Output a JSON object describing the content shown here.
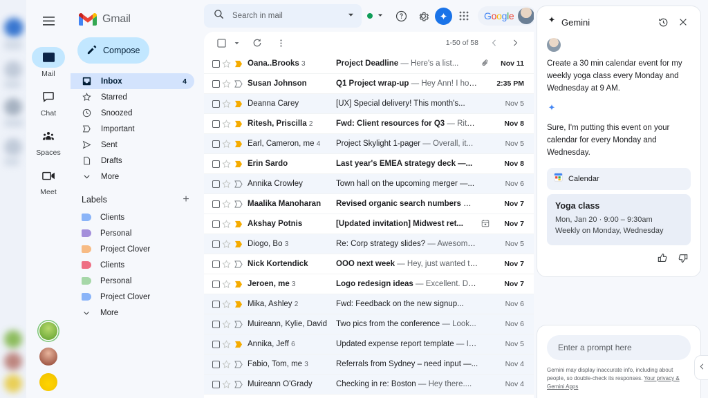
{
  "rail": {
    "menu_icon": "hamburger-icon",
    "items": [
      {
        "label": "Mail",
        "icon": "mail-icon",
        "active": true
      },
      {
        "label": "Chat",
        "icon": "chat-icon",
        "active": false
      },
      {
        "label": "Spaces",
        "icon": "spaces-icon",
        "active": false
      },
      {
        "label": "Meet",
        "icon": "meet-icon",
        "active": false
      }
    ]
  },
  "brand": {
    "name": "Gmail"
  },
  "compose": {
    "label": "Compose",
    "icon": "pencil-icon"
  },
  "nav": {
    "items": [
      {
        "label": "Inbox",
        "icon": "inbox-icon",
        "count": "4",
        "active": true
      },
      {
        "label": "Starred",
        "icon": "star-icon",
        "count": "",
        "active": false
      },
      {
        "label": "Snoozed",
        "icon": "clock-icon",
        "count": "",
        "active": false
      },
      {
        "label": "Important",
        "icon": "important-icon",
        "count": "",
        "active": false
      },
      {
        "label": "Sent",
        "icon": "send-icon",
        "count": "",
        "active": false
      },
      {
        "label": "Drafts",
        "icon": "draft-icon",
        "count": "",
        "active": false
      },
      {
        "label": "More",
        "icon": "chevron-down-icon",
        "count": "",
        "active": false
      }
    ]
  },
  "labels": {
    "title": "Labels",
    "add_icon": "plus-icon",
    "items": [
      {
        "label": "Clients",
        "color": "#8ab4f8"
      },
      {
        "label": "Personal",
        "color": "#a48fdb"
      },
      {
        "label": "Project Clover",
        "color": "#f7bb84"
      },
      {
        "label": "Clients",
        "color": "#ee6f84"
      },
      {
        "label": "Personal",
        "color": "#a6d7a8"
      },
      {
        "label": "Project Clover",
        "color": "#8ab4f8"
      }
    ],
    "more_label": "More",
    "more_icon": "chevron-down-icon"
  },
  "search": {
    "placeholder": "Search in mail",
    "value": "",
    "icon": "search-icon",
    "options_icon": "chevron-down-icon"
  },
  "header_icons": {
    "status_dot": "active-status-dot",
    "status_caret": "chevron-down-icon",
    "help": "help-icon",
    "settings": "gear-icon",
    "gemini": "gemini-sparkle-icon",
    "apps": "apps-grid-icon",
    "google_word": "Google",
    "avatar": "user-avatar"
  },
  "list_toolbar": {
    "select_all_icon": "checkbox-icon",
    "select_caret_icon": "chevron-down-icon",
    "refresh_icon": "refresh-icon",
    "more_icon": "more-vertical-icon",
    "pager_text": "1-50 of 58",
    "prev_icon": "chevron-left-icon",
    "next_icon": "chevron-right-icon"
  },
  "emails": [
    {
      "sender": "Oana..Brooks",
      "count": "3",
      "subject": "Project Deadline",
      "snippet": "— Here's a list...",
      "date": "Nov 11",
      "unread": true,
      "important": "unread-marker",
      "attachment": "paperclip-icon"
    },
    {
      "sender": "Susan Johnson",
      "count": "",
      "subject": "Q1 Project wrap-up",
      "snippet": "— Hey Ann! I hop...",
      "date": "2:35 PM",
      "unread": true,
      "important": "important-marker",
      "attachment": ""
    },
    {
      "sender": "Deanna Carey",
      "count": "",
      "subject": "[UX] Special delivery! This month's...",
      "snippet": "",
      "date": "Nov 5",
      "unread": false,
      "important": "unread-marker",
      "attachment": ""
    },
    {
      "sender": "Ritesh, Priscilla",
      "count": "2",
      "subject": "Fwd: Client resources for Q3",
      "snippet": "— Ritesh,...",
      "date": "Nov 8",
      "unread": true,
      "important": "unread-marker",
      "attachment": ""
    },
    {
      "sender": "Earl, Cameron, me",
      "count": "4",
      "subject": "Project Skylight 1-pager",
      "snippet": "— Overall, it...",
      "date": "Nov 5",
      "unread": false,
      "important": "unread-marker",
      "attachment": ""
    },
    {
      "sender": "Erin Sardo",
      "count": "",
      "subject": "Last year's EMEA strategy deck —...",
      "snippet": "",
      "date": "Nov 8",
      "unread": true,
      "important": "unread-marker",
      "attachment": ""
    },
    {
      "sender": "Annika Crowley",
      "count": "",
      "subject": "Town hall on the upcoming merger —...",
      "snippet": "",
      "date": "Nov 6",
      "unread": false,
      "important": "important-marker",
      "attachment": ""
    },
    {
      "sender": "Maalika Manoharan",
      "count": "",
      "subject": "Revised organic search numbers",
      "snippet": "— Hi,...",
      "date": "Nov 7",
      "unread": true,
      "important": "important-marker",
      "attachment": ""
    },
    {
      "sender": "Akshay Potnis",
      "count": "",
      "subject": "[Updated invitation] Midwest ret...",
      "snippet": "",
      "date": "Nov 7",
      "unread": true,
      "important": "unread-marker",
      "attachment": "calendar-icon"
    },
    {
      "sender": "Diogo, Bo",
      "count": "3",
      "subject": "Re: Corp strategy slides?",
      "snippet": "— Awesome,...",
      "date": "Nov 5",
      "unread": false,
      "important": "unread-marker",
      "attachment": ""
    },
    {
      "sender": "Nick Kortendick",
      "count": "",
      "subject": "OOO next week",
      "snippet": "— Hey, just wanted to...",
      "date": "Nov 7",
      "unread": true,
      "important": "important-marker",
      "attachment": ""
    },
    {
      "sender": "Jeroen, me",
      "count": "3",
      "subject": "Logo redesign ideas",
      "snippet": "— Excellent. Do h...",
      "date": "Nov 7",
      "unread": true,
      "important": "unread-marker",
      "attachment": ""
    },
    {
      "sender": "Mika, Ashley",
      "count": "2",
      "subject": "Fwd: Feedback on the new signup...",
      "snippet": "",
      "date": "Nov 6",
      "unread": false,
      "important": "unread-marker",
      "attachment": ""
    },
    {
      "sender": "Muireann, Kylie, David",
      "count": "",
      "subject": "Two pics from the conference",
      "snippet": "— Look...",
      "date": "Nov 6",
      "unread": false,
      "important": "important-marker",
      "attachment": ""
    },
    {
      "sender": "Annika, Jeff",
      "count": "6",
      "subject": "Updated expense report template",
      "snippet": "— It'...",
      "date": "Nov 5",
      "unread": false,
      "important": "unread-marker",
      "attachment": ""
    },
    {
      "sender": "Fabio, Tom, me",
      "count": "3",
      "subject": "Referrals from Sydney – need input —...",
      "snippet": "",
      "date": "Nov 4",
      "unread": false,
      "important": "important-marker",
      "attachment": ""
    },
    {
      "sender": "Muireann O'Grady",
      "count": "",
      "subject": "Checking in re: Boston",
      "snippet": "— Hey there....",
      "date": "Nov 4",
      "unread": false,
      "important": "important-marker",
      "attachment": ""
    }
  ],
  "gemini": {
    "title": "Gemini",
    "sparkle_icon": "gemini-sparkle-icon",
    "history_icon": "history-icon",
    "close_icon": "close-icon",
    "user_avatar": "user-avatar",
    "user_message": "Create a 30 min calendar event for my weekly yoga class every Monday and Wednesday at 9 AM.",
    "response": "Sure, I'm putting this event on your calendar for every Monday and Wednesday.",
    "tool": {
      "label": "Calendar",
      "icon": "google-calendar-icon"
    },
    "event": {
      "title": "Yoga class",
      "when": "Mon, Jan 20 · 9:00 – 9:30am",
      "recurrence": "Weekly on Monday, Wednesday"
    },
    "thumbs_up_icon": "thumbs-up-icon",
    "thumbs_down_icon": "thumbs-down-icon",
    "prompt_placeholder": "Enter a prompt here",
    "prompt_value": "",
    "disclaimer_text": "Gemini may display inaccurate info, including about people, so double-check its responses. ",
    "disclaimer_link": "Your privacy & Gemini Apps",
    "collapse_icon": "chevron-left-icon"
  },
  "colors": {
    "accent_blue": "#1a73e8",
    "active_nav": "#d3e3fd",
    "compose_bg": "#c2e7ff",
    "unread_marker": "#f5ab00",
    "page_bg": "#f6f8fc",
    "read_row_bg": "#f2f6fc"
  }
}
